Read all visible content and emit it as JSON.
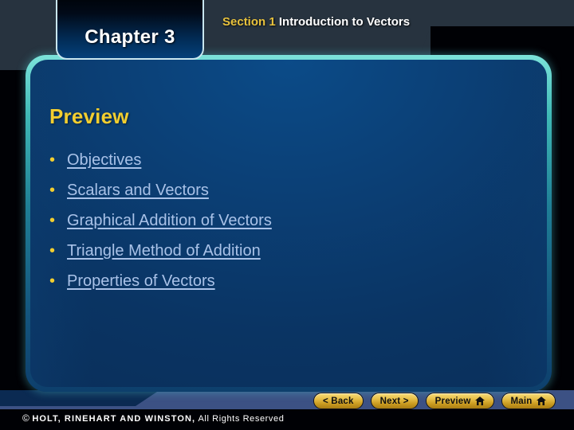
{
  "header": {
    "chapter_label": "Chapter 3",
    "section_number": "Section 1",
    "section_name": "Introduction to Vectors"
  },
  "content": {
    "heading": "Preview",
    "bullet_marker": "•",
    "links": [
      "Objectives",
      "Scalars and Vectors",
      "Graphical Addition of Vectors",
      "Triangle Method of Addition",
      "Properties of Vectors"
    ]
  },
  "navigation": {
    "back_label": "< Back",
    "next_label": "Next >",
    "preview_label": "Preview",
    "main_label": "Main",
    "home_icon": "home-icon"
  },
  "footer": {
    "copyright_symbol": "©",
    "publisher": "HOLT, RINEHART AND WINSTON,",
    "rights": "All Rights Reserved"
  },
  "colors": {
    "accent_gold": "#f2ce30",
    "link_blue": "#a9c2e8",
    "panel_blue": "#0a3463",
    "glow_cyan": "#7ce3da",
    "slate_bg": "#27333f",
    "footer_blue": "#3c5184"
  }
}
